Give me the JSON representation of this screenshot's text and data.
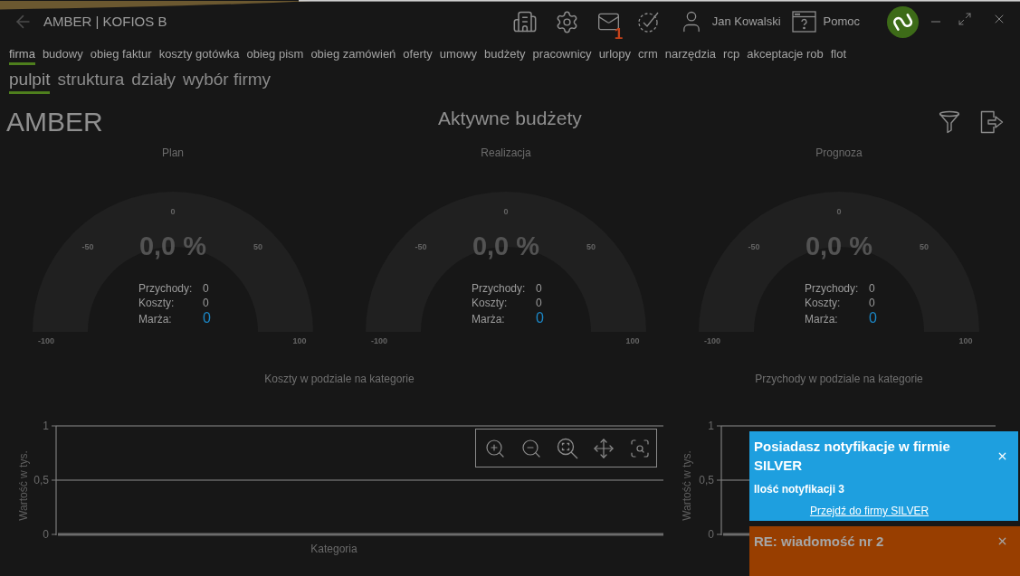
{
  "window": {
    "title": "AMBER | KOFIOS B",
    "mail_badge": "1",
    "user": "Jan Kowalski",
    "help": "Pomoc"
  },
  "menu": [
    {
      "label": "firma",
      "selected": true
    },
    {
      "label": "budowy",
      "selected": false
    },
    {
      "label": "obieg faktur",
      "selected": false
    },
    {
      "label": "koszty gotówka",
      "selected": false
    },
    {
      "label": "obieg pism",
      "selected": false
    },
    {
      "label": "obieg zamówień",
      "selected": false
    },
    {
      "label": "oferty",
      "selected": false
    },
    {
      "label": "umowy",
      "selected": false
    },
    {
      "label": "budżety",
      "selected": false
    },
    {
      "label": "pracownicy",
      "selected": false
    },
    {
      "label": "urlopy",
      "selected": false
    },
    {
      "label": "crm",
      "selected": false
    },
    {
      "label": "narzędzia",
      "selected": false
    },
    {
      "label": "rcp",
      "selected": false
    },
    {
      "label": "akceptacje rob",
      "selected": false
    },
    {
      "label": "flot",
      "selected": false
    }
  ],
  "submenu": [
    {
      "label": "pulpit",
      "selected": true
    },
    {
      "label": "struktura",
      "selected": false
    },
    {
      "label": "działy",
      "selected": false
    },
    {
      "label": "wybór firmy",
      "selected": false
    }
  ],
  "header": {
    "company": "AMBER",
    "title": "Aktywne budżety"
  },
  "gauges": [
    {
      "title": "Plan",
      "value": "0,0 %",
      "ticks": [
        "-100",
        "-50",
        "0",
        "50",
        "100"
      ],
      "stats": [
        {
          "label": "Przychody:",
          "value": "0",
          "kind": "plain"
        },
        {
          "label": "Koszty:",
          "value": "0",
          "kind": "plain"
        },
        {
          "label": "Marża:",
          "value": "0",
          "kind": "highlight"
        }
      ]
    },
    {
      "title": "Realizacja",
      "value": "0,0 %",
      "ticks": [
        "-100",
        "-50",
        "0",
        "50",
        "100"
      ],
      "stats": [
        {
          "label": "Przychody:",
          "value": "0",
          "kind": "plain"
        },
        {
          "label": "Koszty:",
          "value": "0",
          "kind": "plain"
        },
        {
          "label": "Marża:",
          "value": "0",
          "kind": "highlight"
        }
      ]
    },
    {
      "title": "Prognoza",
      "value": "0,0 %",
      "ticks": [
        "-100",
        "-50",
        "0",
        "50",
        "100"
      ],
      "stats": [
        {
          "label": "Przychody:",
          "value": "0",
          "kind": "plain"
        },
        {
          "label": "Koszty:",
          "value": "0",
          "kind": "plain"
        },
        {
          "label": "Marża:",
          "value": "0",
          "kind": "highlight"
        }
      ]
    }
  ],
  "charts": [
    {
      "title": "Koszty w podziale na kategorie",
      "y_axis_title": "Wartość w tys.",
      "y_ticks": [
        "1",
        "0,5",
        "0"
      ],
      "x_axis_title": "Kategoria",
      "toolbar": true
    },
    {
      "title": "Przychody w podziale na kategorie",
      "y_axis_title": "Wartość w tys.",
      "y_ticks": [
        "1",
        "0,5",
        "0"
      ]
    }
  ],
  "notifications": [
    {
      "kind": "info",
      "title": "Posiadasz notyfikacje w firmie SILVER",
      "text": "Ilość notyfikacji 3",
      "link": "Przejdź do firmy SILVER"
    },
    {
      "kind": "message",
      "title": "RE: wiadomość nr 2"
    }
  ]
}
